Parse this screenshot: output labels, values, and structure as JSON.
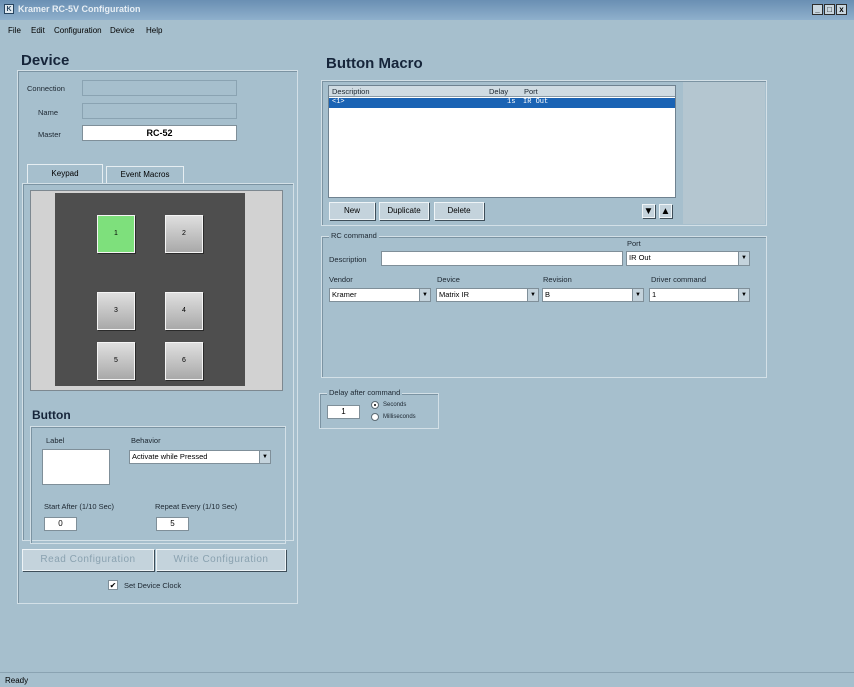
{
  "window": {
    "app_icon_letter": "K",
    "title": "Kramer RC-5V Configuration",
    "controls": [
      "_",
      "□",
      "x"
    ]
  },
  "menu": [
    "File",
    "Edit",
    "Configuration",
    "Device",
    "Help"
  ],
  "device": {
    "heading": "Device",
    "connection_label": "Connection",
    "connection_value": "",
    "name_label": "Name",
    "name_value": "",
    "master_label": "Master",
    "master_value": "RC-52",
    "tabs": [
      "Keypad",
      "Event Macros"
    ],
    "keypad_buttons": [
      "1",
      "2",
      "3",
      "4",
      "5",
      "6"
    ],
    "selected_key": "1"
  },
  "button": {
    "heading": "Button",
    "label_label": "Label",
    "label_value": "",
    "behavior_label": "Behavior",
    "behavior_value": "Activate while Pressed",
    "start_after_label": "Start After (1/10 Sec)",
    "start_after_value": "0",
    "repeat_every_label": "Repeat Every (1/10 Sec)",
    "repeat_every_value": "5"
  },
  "config_buttons": {
    "read": "Read Configuration",
    "write": "Write Configuration"
  },
  "set_device_clock": {
    "label": "Set Device Clock",
    "checked": true
  },
  "macro": {
    "heading": "Button Macro",
    "columns": [
      "Description",
      "Delay",
      "Port"
    ],
    "rows": [
      {
        "description": "<1>",
        "delay": "1s",
        "port": "IR Out",
        "selected": true
      }
    ],
    "new_label": "New",
    "duplicate_label": "Duplicate",
    "delete_label": "Delete",
    "down_glyph": "▼",
    "up_glyph": "▲"
  },
  "rc_command": {
    "group_title": "RC command",
    "description_label": "Description",
    "description_value": "",
    "port_label": "Port",
    "port_value": "IR Out",
    "vendor_label": "Vendor",
    "vendor_value": "Kramer",
    "device_label": "Device",
    "device_value": "Matrix IR",
    "revision_label": "Revision",
    "revision_value": "B",
    "driver_label": "Driver command",
    "driver_value": "1"
  },
  "delay": {
    "group_title": "Delay after command",
    "value": "1",
    "unit_seconds": "Seconds",
    "unit_milliseconds": "Milliseconds",
    "selected_unit": "Seconds"
  },
  "status": "Ready"
}
